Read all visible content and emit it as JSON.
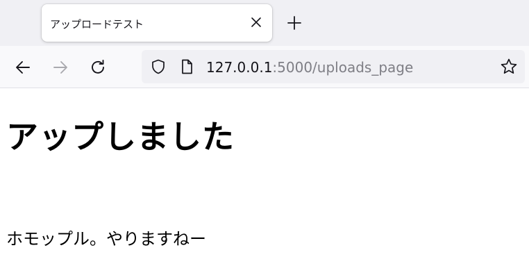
{
  "tab": {
    "title": "アップロードテスト"
  },
  "navbar": {
    "url_host": "127.0.0.1",
    "url_rest": ":5000/uploads_page"
  },
  "page": {
    "heading": "アップしました",
    "paragraph": "ホモップル。やりますねー"
  }
}
